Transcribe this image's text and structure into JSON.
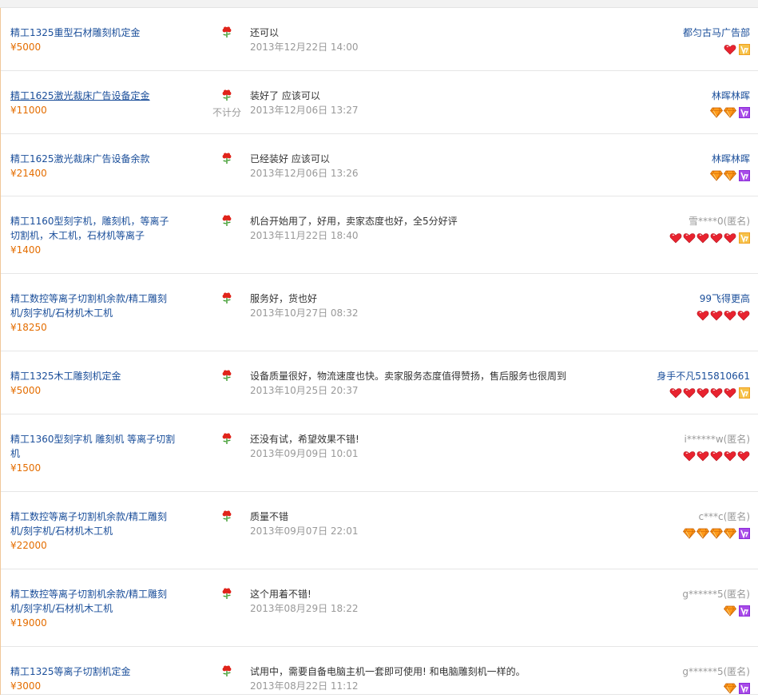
{
  "rows": [
    {
      "title": "精工1325重型石材雕刻机定金",
      "price": "¥5000",
      "comment": "还可以",
      "time": "2013年12月22日 14:00",
      "user": "都匀古马广告部",
      "anon": false,
      "badge": "heart",
      "count": 1,
      "vip": "gold",
      "nocount": "",
      "underline": false
    },
    {
      "title": "精工1625激光裁床广告设备定金",
      "price": "¥11000",
      "comment": "装好了 应该可以",
      "time": "2013年12月06日 13:27",
      "user": "林晖林晖",
      "anon": false,
      "badge": "diamond",
      "count": 2,
      "vip": "purple",
      "nocount": "不计分",
      "underline": true
    },
    {
      "title": "精工1625激光裁床广告设备余款",
      "price": "¥21400",
      "comment": "已经装好 应该可以",
      "time": "2013年12月06日 13:26",
      "user": "林晖林晖",
      "anon": false,
      "badge": "diamond",
      "count": 2,
      "vip": "purple",
      "nocount": "",
      "underline": false
    },
    {
      "title": "精工1160型刻字机，雕刻机，等离子切割机，木工机，石材机等离子",
      "price": "¥1400",
      "comment": "机台开始用了，好用，卖家态度也好，全5分好评",
      "time": "2013年11月22日 18:40",
      "user": "雪****0(匿名)",
      "anon": true,
      "badge": "heart",
      "count": 5,
      "vip": "gold",
      "nocount": "",
      "underline": false
    },
    {
      "title": "精工数控等离子切割机余款/精工雕刻机/刻字机/石材机木工机",
      "price": "¥18250",
      "comment": "服务好，货也好",
      "time": "2013年10月27日 08:32",
      "user": "99飞得更高",
      "anon": false,
      "badge": "heart",
      "count": 4,
      "vip": "none",
      "nocount": "",
      "underline": false
    },
    {
      "title": "精工1325木工雕刻机定金",
      "price": "¥5000",
      "comment": "设备质量很好，物流速度也快。卖家服务态度值得赞扬，售后服务也很周到",
      "time": "2013年10月25日 20:37",
      "user": "身手不凡515810661",
      "anon": false,
      "badge": "heart",
      "count": 5,
      "vip": "gold",
      "nocount": "",
      "underline": false
    },
    {
      "title": "精工1360型刻字机 雕刻机 等离子切割机",
      "price": "¥1500",
      "comment": "还没有试，希望效果不错!",
      "time": "2013年09月09日 10:01",
      "user": "i******w(匿名)",
      "anon": true,
      "badge": "heart",
      "count": 5,
      "vip": "none",
      "nocount": "",
      "underline": false
    },
    {
      "title": "精工数控等离子切割机余款/精工雕刻机/刻字机/石材机木工机",
      "price": "¥22000",
      "comment": "质量不错",
      "time": "2013年09月07日 22:01",
      "user": "c***c(匿名)",
      "anon": true,
      "badge": "diamond",
      "count": 4,
      "vip": "purple",
      "nocount": "",
      "underline": false
    },
    {
      "title": "精工数控等离子切割机余款/精工雕刻机/刻字机/石材机木工机",
      "price": "¥19000",
      "comment": "这个用着不错!",
      "time": "2013年08月29日 18:22",
      "user": "g******5(匿名)",
      "anon": true,
      "badge": "diamond",
      "count": 1,
      "vip": "purple",
      "nocount": "",
      "underline": false
    },
    {
      "title": "精工1325等离子切割机定金",
      "price": "¥3000",
      "comment": "试用中，需要自备电脑主机一套即可使用! 和电脑雕刻机一样的。",
      "time": "2013年08月22日 11:12",
      "user": "g******5(匿名)",
      "anon": true,
      "badge": "diamond",
      "count": 1,
      "vip": "purple",
      "nocount": "",
      "underline": false
    }
  ],
  "colors": {
    "link": "#1a4e9a",
    "price": "#e46d00",
    "muted": "#999999"
  }
}
